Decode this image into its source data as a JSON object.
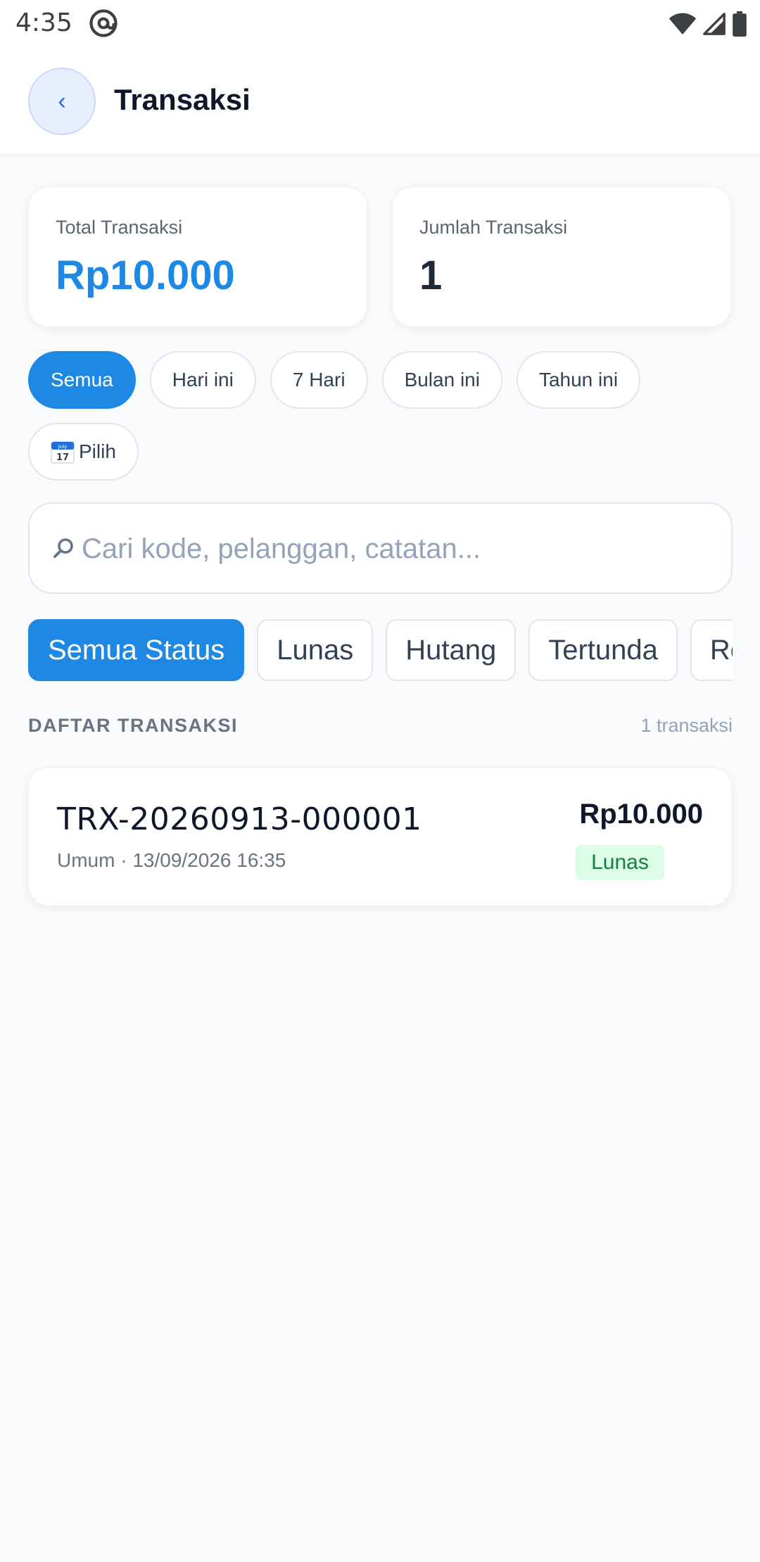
{
  "status_bar": {
    "time": "4:35"
  },
  "header": {
    "title": "Transaksi",
    "back_glyph": "‹"
  },
  "summary": {
    "total": {
      "label": "Total Transaksi",
      "value": "Rp10.000",
      "color": "#1e88e5"
    },
    "count": {
      "label": "Jumlah Transaksi",
      "value": "1",
      "color": "#1f2937"
    }
  },
  "date_filters": {
    "items": [
      "Semua",
      "Hari ini",
      "7 Hari",
      "Bulan ini",
      "Tahun ini"
    ],
    "active": "Semua",
    "picker": {
      "calendar_month": "July",
      "calendar_day": "17",
      "label": "Pilih"
    }
  },
  "search": {
    "placeholder": "Cari kode, pelanggan, catatan...",
    "value": ""
  },
  "status_filters": {
    "items": [
      "Semua Status",
      "Lunas",
      "Hutang",
      "Tertunda",
      "Refund"
    ],
    "active": "Semua Status"
  },
  "list": {
    "heading": "DAFTAR TRANSAKSI",
    "count_label": "1 transaksi",
    "transactions": [
      {
        "code": "TRX-20260913-000001",
        "meta": "Umum · 13/09/2026 16:35",
        "amount": "Rp10.000",
        "status": "Lunas"
      }
    ]
  },
  "colors": {
    "accent": "#1e88e5",
    "paid_badge_bg": "#dcfce7",
    "paid_badge_text": "#15803d",
    "background": "#f8fafc"
  }
}
